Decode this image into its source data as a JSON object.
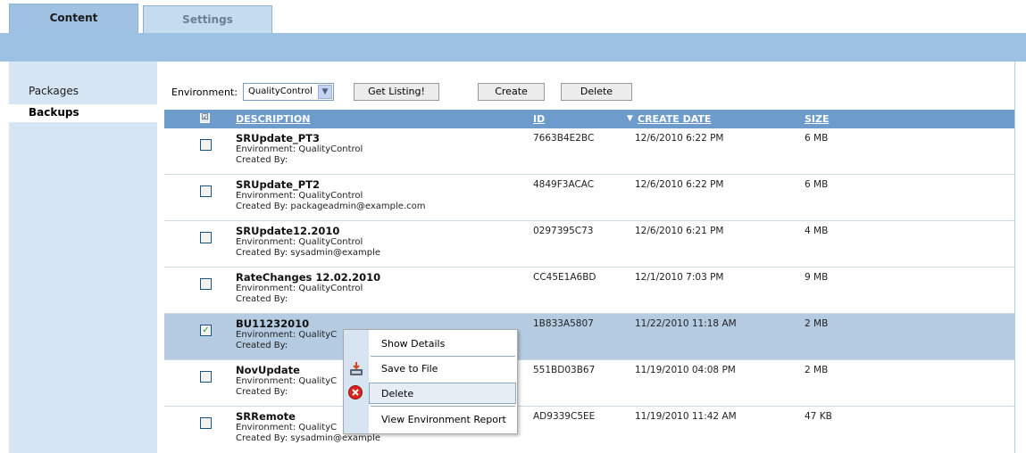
{
  "tabs": [
    {
      "label": "Content",
      "active": true
    },
    {
      "label": "Settings",
      "active": false
    }
  ],
  "sidebar": {
    "items": [
      {
        "label": "Packages",
        "active": false
      },
      {
        "label": "Backups",
        "active": true
      }
    ]
  },
  "toolbar": {
    "environment_label": "Environment:",
    "environment_value": "QualityControl",
    "get_listing_label": "Get Listing!",
    "create_label": "Create",
    "delete_label": "Delete"
  },
  "table": {
    "headers": {
      "description": "DESCRIPTION",
      "id": "ID",
      "create_date": "CREATE DATE",
      "size": "SIZE",
      "sort_indicator": "▼"
    },
    "rows": [
      {
        "name": "SRUpdate_PT3",
        "environment": "Environment: QualityControl",
        "created_by": "Created By:",
        "id": "7663B4E2BC",
        "date": "12/6/2010 6:22 PM",
        "size": "6 MB",
        "checked": false
      },
      {
        "name": "SRUpdate_PT2",
        "environment": "Environment: QualityControl",
        "created_by": "Created By: packageadmin@example.com",
        "id": "4849F3ACAC",
        "date": "12/6/2010 6:22 PM",
        "size": "6 MB",
        "checked": false
      },
      {
        "name": "SRUpdate12.2010",
        "environment": "Environment: QualityControl",
        "created_by": "Created By: sysadmin@example",
        "id": "0297395C73",
        "date": "12/6/2010 6:21 PM",
        "size": "4 MB",
        "checked": false
      },
      {
        "name": "RateChanges 12.02.2010",
        "environment": "Environment: QualityControl",
        "created_by": "Created By:",
        "id": "CC45E1A6BD",
        "date": "12/1/2010 7:03 PM",
        "size": "9 MB",
        "checked": false
      },
      {
        "name": "BU11232010",
        "environment": "Environment: QualityC",
        "created_by": "Created By:",
        "id": "1B833A5807",
        "date": "11/22/2010 11:18 AM",
        "size": "2 MB",
        "checked": true
      },
      {
        "name": "NovUpdate",
        "environment": "Environment: QualityC",
        "created_by": "Created By:",
        "id": "551BD03B67",
        "date": "11/19/2010 04:08 PM",
        "size": "2 MB",
        "checked": false
      },
      {
        "name": "SRRemote",
        "environment": "Environment: QualityC",
        "created_by": "Created By: sysadmin@example",
        "id": "AD9339C5EE",
        "date": "11/19/2010 11:42 AM",
        "size": "47 KB",
        "checked": false
      }
    ]
  },
  "context_menu": {
    "items": [
      {
        "label": "Show Details",
        "icon": "none"
      },
      {
        "label": "Save to File",
        "icon": "save-icon"
      },
      {
        "label": "Delete",
        "icon": "delete-icon"
      },
      {
        "label": "View Environment Report",
        "icon": "none"
      }
    ]
  },
  "colors": {
    "header_bar": "#6d9bcb",
    "banner": "#9cc1e3",
    "sidebar": "#d6e5f3",
    "selected_row": "#b4cbe1"
  }
}
